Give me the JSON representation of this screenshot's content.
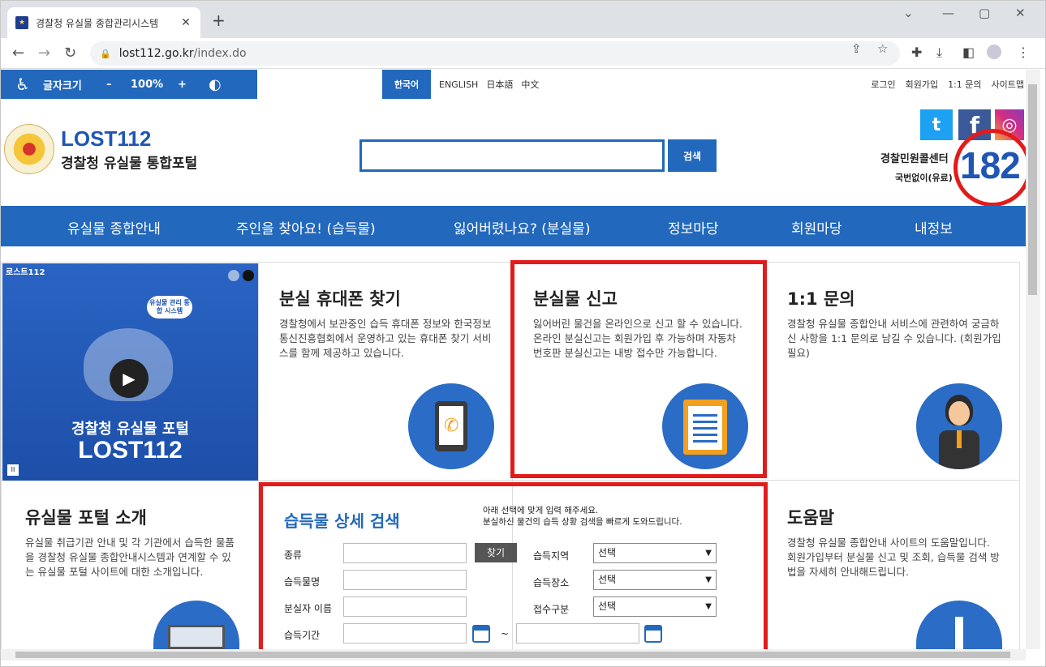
{
  "browser": {
    "tab_title": "경찰청 유실물 종합관리시스템",
    "url_host": "lost112.go.kr",
    "url_path": "/index.do"
  },
  "util": {
    "font_size_label": "글자크기",
    "minus": "–",
    "zoom": "100%",
    "plus": "+",
    "languages": [
      "한국어",
      "ENGLISH",
      "日本語",
      "中文"
    ],
    "member_links": [
      "로그인",
      "회원가입",
      "1:1 문의",
      "사이트맵"
    ]
  },
  "header": {
    "logo_title": "LOST112",
    "logo_subtitle": "경찰청 유실물 통합포털",
    "search_button": "검색",
    "call_center": "경찰민원콜센터",
    "call_center_sub": "국번없이(유료)",
    "call_number": "182"
  },
  "nav": [
    "유실물 종합안내",
    "주인을 찾아요! (습득물)",
    "잃어버렸나요? (분실물)",
    "정보마당",
    "회원마당",
    "내정보"
  ],
  "video": {
    "label": "로스트112",
    "bubble": "유실물 관리 통합 시스템",
    "caption1": "경찰청 유실물 포털",
    "caption2": "LOST112",
    "pause": "II"
  },
  "cards": {
    "phone": {
      "title": "분실 휴대폰 찾기",
      "text": "경찰청에서 보관중인 습득 휴대폰 정보와 한국정보통신진흥협회에서 운영하고 있는 휴대폰 찾기 서비스를 함께 제공하고 있습니다."
    },
    "report": {
      "title": "분실물 신고",
      "text": "잃어버린 물건을 온라인으로 신고 할 수 있습니다. 온라인 분실신고는 회원가입 후 가능하며 자동차 번호판 분실신고는 내방 접수만 가능합니다."
    },
    "inquiry": {
      "title": "1:1 문의",
      "text": "경찰청 유실물 종합안내 서비스에 관련하여 궁금하신 사항을 1:1 문의로 남길 수 있습니다. (회원가입 필요)"
    },
    "intro": {
      "title": "유실물 포털 소개",
      "text": "유실물 취급기관 안내 및 각 기관에서 습득한 물품을 경찰청 유실물 종합안내시스템과 연계할 수 있는 유실물 포털 사이트에 대한 소개입니다."
    },
    "help": {
      "title": "도움말",
      "text": "경찰청 유실물 종합안내 사이트의 도움말입니다. 회원가입부터 분실물 신고 및 조회, 습득물 검색 방법을 자세히 안내해드립니다."
    }
  },
  "detail_search": {
    "title": "습득물 상세 검색",
    "note1": "아래 선택에 맞게 입력 해주세요.",
    "note2": "분실하신 물건의 습득 상황 검색을 빠르게 도와드립니다.",
    "label_kind": "종류",
    "find_button": "찾기",
    "label_item": "습득물명",
    "label_owner": "분실자 이름",
    "label_period": "습득기간",
    "tilde": "~",
    "label_region": "습득지역",
    "label_place": "습득장소",
    "label_type": "접수구분",
    "select_default": "선택"
  },
  "colors": {
    "primary": "#2268bc",
    "highlight": "#e21b1b"
  }
}
